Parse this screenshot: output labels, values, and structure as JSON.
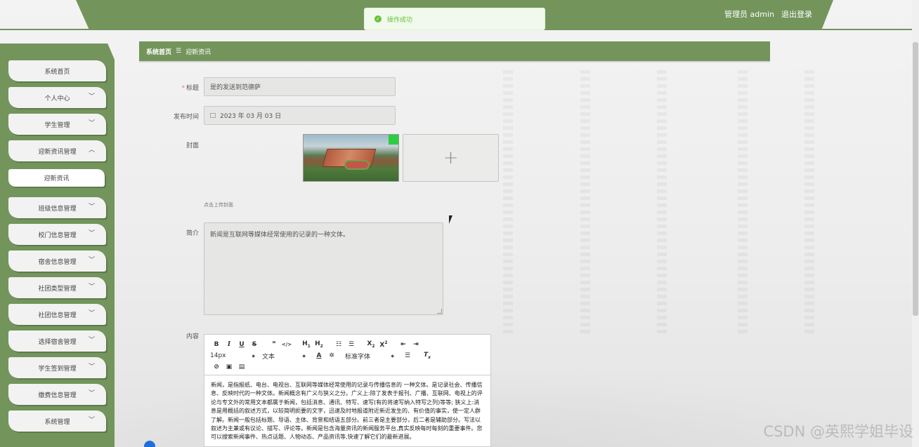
{
  "header": {
    "user_label": "管理员 admin",
    "logout": "退出登录"
  },
  "toast": {
    "message": "操作成功"
  },
  "sidebar": {
    "items": [
      {
        "label": "系统首页",
        "has_chevron": false
      },
      {
        "label": "个人中心",
        "has_chevron": true
      },
      {
        "label": "学生管理",
        "has_chevron": true
      },
      {
        "label": "迎新资讯管理",
        "has_chevron": true,
        "expanded": true
      },
      {
        "label": "迎新资讯",
        "sub": true
      },
      {
        "label": "班级信息管理",
        "has_chevron": true
      },
      {
        "label": "校门信息管理",
        "has_chevron": true
      },
      {
        "label": "宿舍信息管理",
        "has_chevron": true
      },
      {
        "label": "社团类型管理",
        "has_chevron": true
      },
      {
        "label": "社团信息管理",
        "has_chevron": true
      },
      {
        "label": "选择宿舍管理",
        "has_chevron": true
      },
      {
        "label": "学生签到管理",
        "has_chevron": true
      },
      {
        "label": "缴费信息管理",
        "has_chevron": true
      },
      {
        "label": "系统管理",
        "has_chevron": true
      }
    ]
  },
  "breadcrumb": {
    "home": "系统首页",
    "separator": "☰",
    "current": "迎新资讯"
  },
  "form": {
    "title_label": "标题",
    "title_value": "是的发送到范德萨",
    "date_label": "发布时间",
    "date_value": "2023 年 03 月 03 日",
    "cover_label": "封面",
    "cover_tip": "点击上传封面",
    "intro_label": "简介",
    "intro_value": "新闻是互联网等媒体经常使用的记录的一种文体。",
    "content_label": "内容"
  },
  "editor": {
    "font_size": "14px",
    "heading": "文本",
    "font_family": "标准字体",
    "content": "新闻，是指报纸、电台、电视台、互联网等媒体经常使用的记录与传播信息的 一种文体。是记录社会、传播信息、反映时代的一种文体。新闻概念有广义与狭义之分。广义上:除了发表于报刊、广播、互联网、电视上的评论与专文外的常用文本都属于新闻，包括消息、通讯、特写、速写(有的将速写纳入特写之列)等等; 狭义上:消息是用概括的叙述方式，以较简明扼要的文字，迅速及时地报道附近新近发生的、有价值的事实，使一定人群了解。新闻一般包括标题、导语、主体、背景和结语五部分。前三者是主要部分，后二者是辅助部分。写法以叙述为主兼或有议论、描写、评论等。新闻是包含海量资讯的新闻服务平台,真实反映每时每刻的重要事件。您可以搜索新闻事件、热点话题、人物动态、产品资讯等,快速了解它们的最新进展。"
  },
  "watermark": "CSDN @英熙学姐毕设",
  "colors": {
    "theme_green": "#73955c",
    "success": "#67c23a",
    "required": "#f56c6c"
  }
}
